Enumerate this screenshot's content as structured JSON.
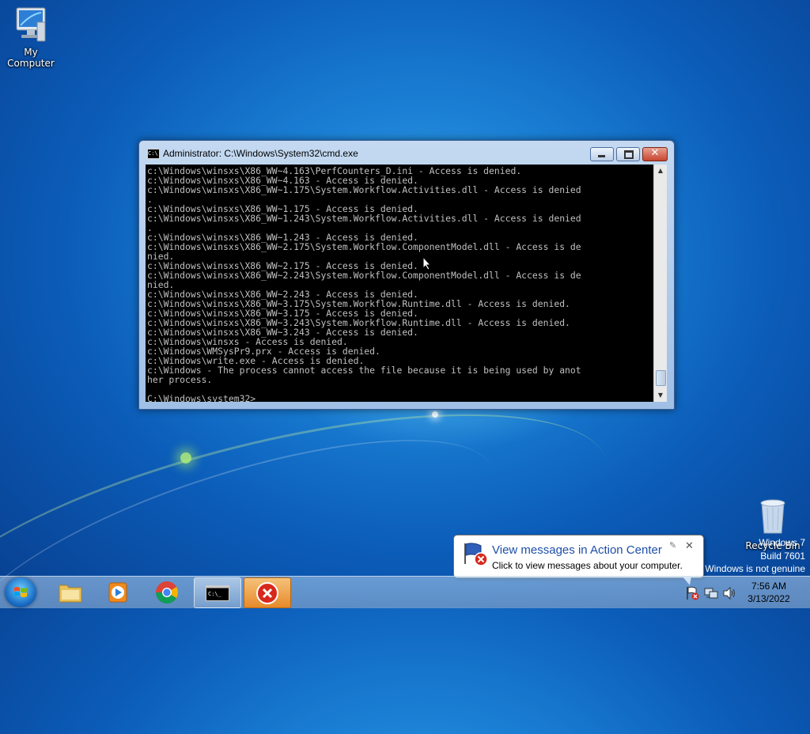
{
  "desktop": {
    "icons": [
      {
        "label": "My Computer"
      },
      {
        "label": "Recycle Bin"
      }
    ]
  },
  "cmd_window": {
    "title": "Administrator: C:\\Windows\\System32\\cmd.exe",
    "console_lines": [
      "c:\\Windows\\winsxs\\X86_WW~4.163\\PerfCounters_D.ini - Access is denied.",
      "c:\\Windows\\winsxs\\X86_WW~4.163 - Access is denied.",
      "c:\\Windows\\winsxs\\X86_WW~1.175\\System.Workflow.Activities.dll - Access is denied",
      ".",
      "c:\\Windows\\winsxs\\X86_WW~1.175 - Access is denied.",
      "c:\\Windows\\winsxs\\X86_WW~1.243\\System.Workflow.Activities.dll - Access is denied",
      ".",
      "c:\\Windows\\winsxs\\X86_WW~1.243 - Access is denied.",
      "c:\\Windows\\winsxs\\X86_WW~2.175\\System.Workflow.ComponentModel.dll - Access is de",
      "nied.",
      "c:\\Windows\\winsxs\\X86_WW~2.175 - Access is denied.",
      "c:\\Windows\\winsxs\\X86_WW~2.243\\System.Workflow.ComponentModel.dll - Access is de",
      "nied.",
      "c:\\Windows\\winsxs\\X86_WW~2.243 - Access is denied.",
      "c:\\Windows\\winsxs\\X86_WW~3.175\\System.Workflow.Runtime.dll - Access is denied.",
      "c:\\Windows\\winsxs\\X86_WW~3.175 - Access is denied.",
      "c:\\Windows\\winsxs\\X86_WW~3.243\\System.Workflow.Runtime.dll - Access is denied.",
      "c:\\Windows\\winsxs\\X86_WW~3.243 - Access is denied.",
      "c:\\Windows\\winsxs - Access is denied.",
      "c:\\Windows\\WMSysPr9.prx - Access is denied.",
      "c:\\Windows\\write.exe - Access is denied.",
      "c:\\Windows - The process cannot access the file because it is being used by anot",
      "her process.",
      "",
      "C:\\Windows\\system32>"
    ]
  },
  "taskbar": {
    "items": [
      {
        "name": "windows-explorer"
      },
      {
        "name": "windows-media-player"
      },
      {
        "name": "google-chrome"
      },
      {
        "name": "command-prompt"
      },
      {
        "name": "error-app"
      }
    ]
  },
  "balloon": {
    "title": "View messages in Action Center",
    "text": "Click to view messages about your computer."
  },
  "tray": {
    "time": "7:56 AM",
    "date": "3/13/2022"
  },
  "watermark": {
    "line1": "Windows 7",
    "line2": "Build 7601",
    "line3": "Windows is not genuine"
  },
  "colors": {
    "console_bg": "#000000",
    "console_fg": "#c0c0c0",
    "close_red": "#c8452f",
    "balloon_title": "#1e4ea8"
  }
}
